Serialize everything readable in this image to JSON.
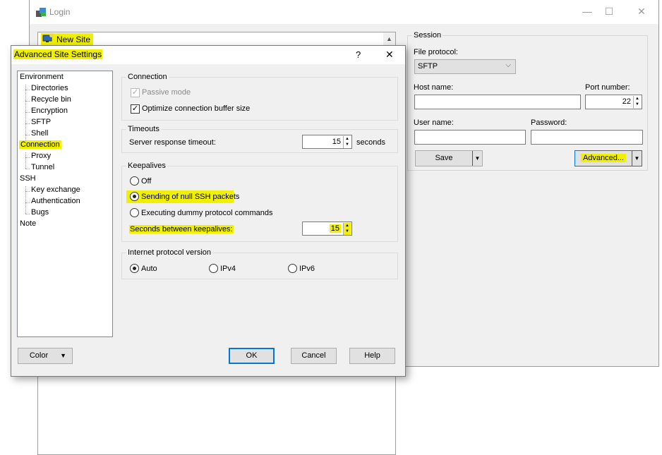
{
  "login": {
    "title": "Login",
    "site_list": {
      "items": [
        {
          "label": "New Site",
          "icon": "monitor-new-icon"
        }
      ]
    },
    "session": {
      "group_title": "Session",
      "file_protocol_label": "File protocol:",
      "file_protocol_value": "SFTP",
      "host_name_label": "Host name:",
      "host_name_value": "",
      "port_label": "Port number:",
      "port_value": "22",
      "user_name_label": "User name:",
      "user_name_value": "",
      "password_label": "Password:",
      "password_value": "",
      "save_label": "Save",
      "advanced_label": "Advanced..."
    }
  },
  "advanced": {
    "title": "Advanced Site Settings",
    "help_glyph": "?",
    "close_glyph": "✕",
    "tree": [
      {
        "label": "Environment",
        "level": 0
      },
      {
        "label": "Directories",
        "level": 1
      },
      {
        "label": "Recycle bin",
        "level": 1
      },
      {
        "label": "Encryption",
        "level": 1
      },
      {
        "label": "SFTP",
        "level": 1
      },
      {
        "label": "Shell",
        "level": 1
      },
      {
        "label": "Connection",
        "level": 0,
        "selected": true
      },
      {
        "label": "Proxy",
        "level": 1
      },
      {
        "label": "Tunnel",
        "level": 1
      },
      {
        "label": "SSH",
        "level": 0
      },
      {
        "label": "Key exchange",
        "level": 1
      },
      {
        "label": "Authentication",
        "level": 1
      },
      {
        "label": "Bugs",
        "level": 1
      },
      {
        "label": "Note",
        "level": 0
      }
    ],
    "connection": {
      "title": "Connection",
      "passive_mode": "Passive mode",
      "optimize_buffer": "Optimize connection buffer size"
    },
    "timeouts": {
      "title": "Timeouts",
      "server_response_label": "Server response timeout:",
      "server_response_value": "15",
      "unit": "seconds"
    },
    "keepalives": {
      "title": "Keepalives",
      "off": "Off",
      "null_packets": "Sending of null SSH packets",
      "dummy_commands": "Executing dummy protocol commands",
      "seconds_label": "Seconds between keepalives:",
      "seconds_value": "15"
    },
    "ip_version": {
      "title": "Internet protocol version",
      "auto": "Auto",
      "ipv4": "IPv4",
      "ipv6": "IPv6"
    },
    "buttons": {
      "color": "Color",
      "ok": "OK",
      "cancel": "Cancel",
      "help": "Help"
    }
  }
}
